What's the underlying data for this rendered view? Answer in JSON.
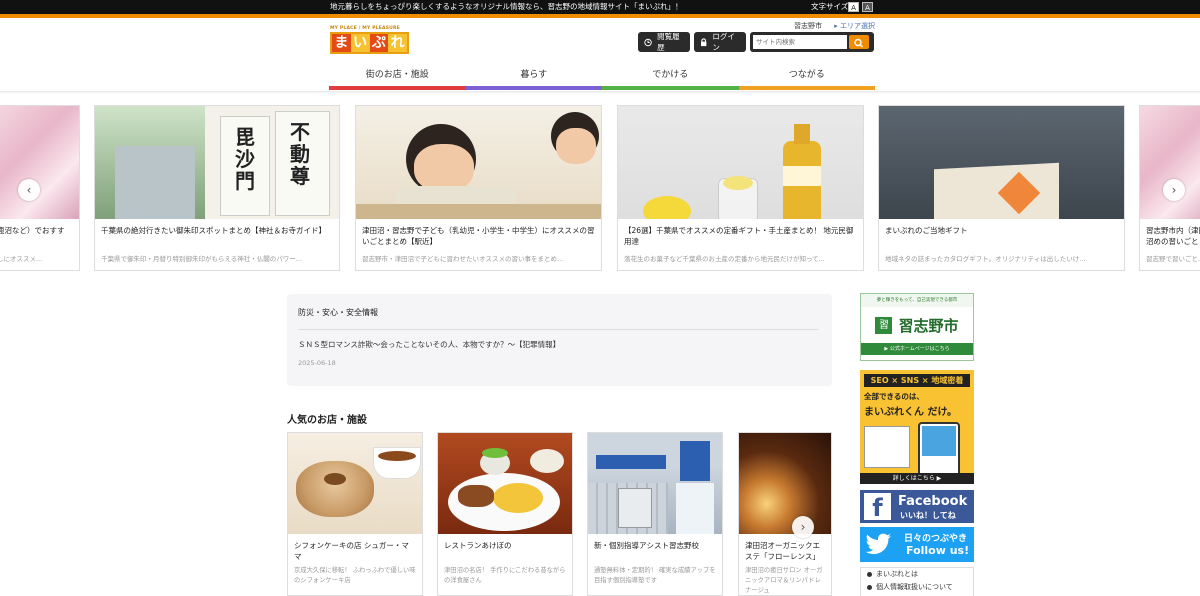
{
  "topbar": {
    "message": "地元暮らしをちょっぴり楽しくするようなオリジナル情報なら、習志野の地域情報サイト「まいぷれ」！",
    "font_size_label": "文字サイズ",
    "font_small": "A",
    "font_large": "A"
  },
  "logo": {
    "tagline": "MY PLACE / MY PLEASURE",
    "chars": [
      "ま",
      "い",
      "ぷ",
      "れ"
    ]
  },
  "location": {
    "city": "習志野市",
    "area_select": "エリア選択"
  },
  "header": {
    "history_label": "閲覧履歴",
    "login_label": "ログイン",
    "search_placeholder": "サイト内検索"
  },
  "nav": {
    "items": [
      "街のお店・施設",
      "暮らす",
      "でかける",
      "つながる"
    ]
  },
  "carousel": [
    {
      "title": "鹿沼など）でおすす",
      "desc": "しにオススメ..."
    },
    {
      "title": "千葉県の絶対行きたい御朱印スポットまとめ【神社＆お寺ガイド】",
      "desc": "千葉県で御朱印・月替り特別御朱印がもらえる神社・仏閣のパワー..."
    },
    {
      "title": "津田沼・習志野で子ども（乳幼児・小学生・中学生）にオススメの習いごとまとめ【駅近】",
      "desc": "習志野市・津田沼で子どもに習わせたいオススメの習い事をまとめ..."
    },
    {
      "title": "【26選】千葉県でオススメの定番ギフト・手土産まとめ！ 地元民御用達",
      "desc": "落花生のお菓子など千葉県のお土産の定番から地元民だけが知って..."
    },
    {
      "title": "まいぷれのご当地ギフト",
      "desc": "地域ネタの詰まったカタログギフト。オリジナリティは出したいけ..."
    },
    {
      "title": "習志野市内（津田沼めの習いごと・",
      "desc": "習志野で習いごと..."
    }
  ],
  "disaster": {
    "heading": "防災・安心・安全情報",
    "article": "ＳＮＳ型ロマンス詐欺〜会ったことないその人、本物ですか？〜【犯罪情報】",
    "date": "2025-06-18"
  },
  "popular": {
    "heading": "人気のお店・施設",
    "items": [
      {
        "title": "シフォンケーキの店 シュガー・ママ",
        "desc": "京成大久保に移転！ ふわっふわで優しい味のシフォンケーキ店"
      },
      {
        "title": "レストランあけぼの",
        "desc": "津田沼の名店！ 手作りにこだわる昔ながらの洋食屋さん"
      },
      {
        "title": "新・個別指導アシスト習志野校",
        "desc": "通塾無料体・定期的！ 確実な成績アップを目指す個別指導塾です"
      },
      {
        "title": "津田沼オーガニックエステ「フローレンス」",
        "desc": "津田沼の癒日サロン オーガニックアロマ＆リンパドレナージュ"
      }
    ]
  },
  "sidebar": {
    "city_banner": {
      "top": "夢と輝きをもって、自己実現できる都市",
      "name": "習志野市",
      "bottom": "▶ 公式ホームページはこちら"
    },
    "seo_banner": {
      "line1": "SEO × SNS × 地域密着",
      "line2": "全部できるのは、",
      "line3": "まいぷれくん だけ。",
      "footer": "詳しくはこちら ▶"
    },
    "facebook": {
      "title": "Facebook",
      "sub": "いいね！してね"
    },
    "twitter": {
      "title": "日々のつぶやき",
      "sub": "Follow us!"
    },
    "links": [
      "まいぷれとは",
      "個人情報取扱いについて"
    ]
  },
  "colors": {
    "accent": "#f08c00",
    "nav1": "#e03c3c",
    "nav2": "#7b61d6",
    "nav3": "#52b147",
    "nav4": "#f0a020"
  }
}
